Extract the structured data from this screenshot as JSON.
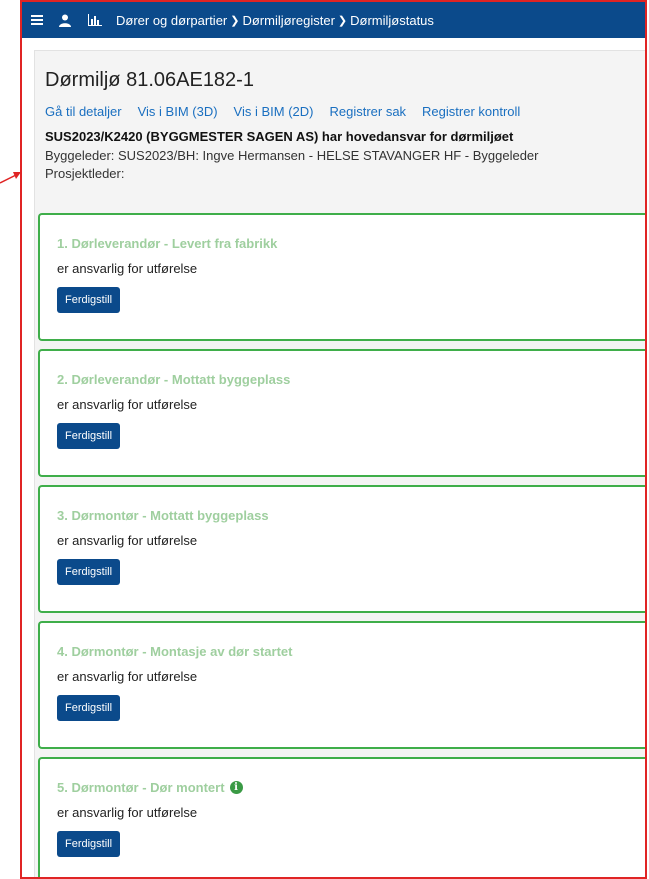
{
  "header": {
    "breadcrumb": [
      "Dører og dørpartier",
      "Dørmiljøregister",
      "Dørmiljøstatus"
    ],
    "icons": [
      "menu-icon",
      "person-icon",
      "bar-chart-icon",
      "chevron-right-icon"
    ]
  },
  "page": {
    "title": "Dørmiljø 81.06AE182-1",
    "links": [
      "Gå til detaljer",
      "Vis i BIM (3D)",
      "Vis i BIM (2D)",
      "Registrer sak",
      "Registrer kontroll"
    ],
    "responsible": "SUS2023/K2420 (BYGGMESTER SAGEN AS) har hovedansvar for dørmiljøet",
    "byggeleder": "Byggeleder: SUS2023/BH: Ingve Hermansen - HELSE STAVANGER HF - Byggeleder",
    "prosjektleder": "Prosjektleder:"
  },
  "steps": [
    {
      "title": "1. Dørleverandør - Levert fra fabrikk",
      "subtitle": "er ansvarlig for utførelse",
      "button": "Ferdigstill"
    },
    {
      "title": "2. Dørleverandør - Mottatt byggeplass",
      "subtitle": "er ansvarlig for utførelse",
      "button": "Ferdigstill"
    },
    {
      "title": "3. Dørmontør - Mottatt byggeplass",
      "subtitle": "er ansvarlig for utførelse",
      "button": "Ferdigstill"
    },
    {
      "title": "4. Dørmontør - Montasje av dør startet",
      "subtitle": "er ansvarlig for utførelse",
      "button": "Ferdigstill"
    },
    {
      "title": "5. Dørmontør - Dør montert",
      "subtitle": "er ansvarlig for utførelse",
      "button": "Ferdigstill",
      "info_icon": "info-icon"
    }
  ],
  "colors": {
    "header_bg": "#0b4a8b",
    "step_border": "#3fae4a",
    "step_title": "#9fcf9f",
    "link": "#1a6fc0",
    "annotation_red": "#e02424"
  }
}
